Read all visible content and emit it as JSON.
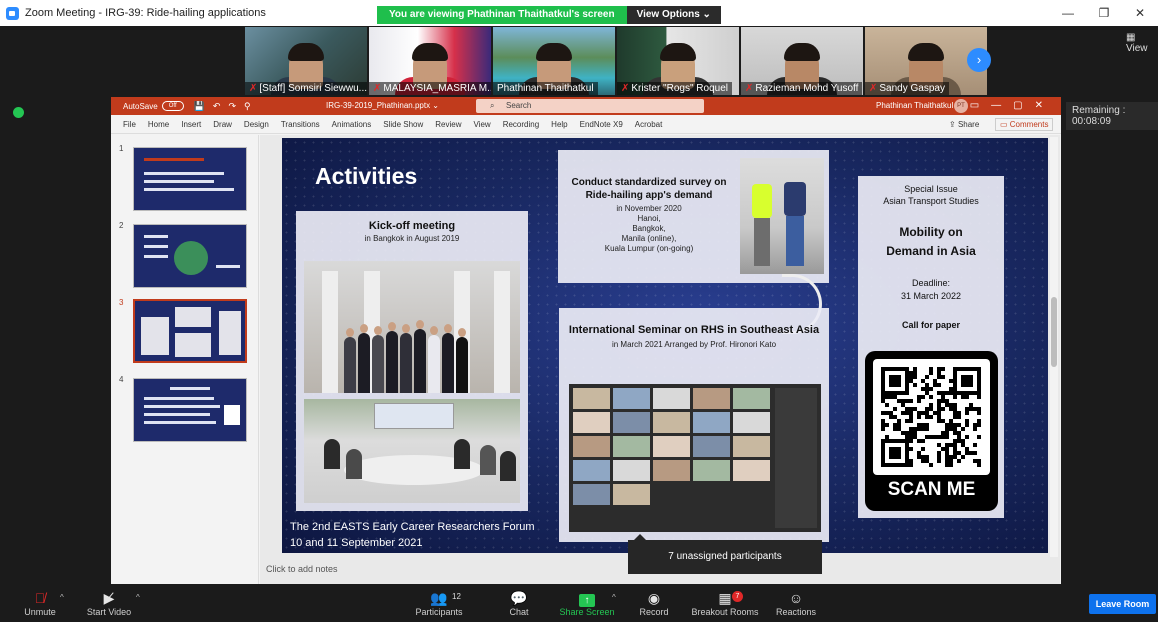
{
  "window": {
    "title": "Zoom Meeting - IRG-39: Ride-hailing applications",
    "controls": [
      "—",
      "❐",
      "✕"
    ]
  },
  "banner": {
    "viewing": "You are viewing Phathinan Thaithatkul's screen",
    "options": "View Options ⌄"
  },
  "participants_strip": [
    {
      "name": "[Staff] Somsiri Siewwu..."
    },
    {
      "name": "MALAYSIA_MASRIA M..."
    },
    {
      "name": "Phathinan Thaithatkul"
    },
    {
      "name": "Krister \"Rogs\" Roquel"
    },
    {
      "name": "Razieman Mohd Yusoff"
    },
    {
      "name": "Sandy Gaspay"
    }
  ],
  "view_label": "View",
  "remaining": "Remaining : 00:08:09",
  "ppt": {
    "autosave": "AutoSave",
    "autosave_state": "Off",
    "filename": "IRG-39-2019_Phathinan.pptx ⌄",
    "search_placeholder": "Search",
    "user": "Phathinan Thaithatkul",
    "avatar_initials": "PT",
    "tabs": [
      "File",
      "Home",
      "Insert",
      "Draw",
      "Design",
      "Transitions",
      "Animations",
      "Slide Show",
      "Review",
      "View",
      "Recording",
      "Help",
      "EndNote X9",
      "Acrobat"
    ],
    "share": "Share",
    "comments": "Comments",
    "slide_numbers": [
      "1",
      "2",
      "3",
      "4"
    ],
    "notes_placeholder": "Click to add notes"
  },
  "slide": {
    "title": "Activities",
    "kickoff": {
      "heading": "Kick-off meeting",
      "sub": "in Bangkok in August 2019"
    },
    "survey": {
      "heading": "Conduct standardized survey on Ride-hailing app's demand",
      "lines": [
        "in November 2020",
        "Hanoi,",
        "Bangkok,",
        "Manila (online),",
        "Kuala Lumpur (on-going)"
      ]
    },
    "seminar": {
      "heading": "International Seminar on RHS in Southeast Asia",
      "sub": "in March 2021 Arranged by Prof. Hironori Kato"
    },
    "special": {
      "line1": "Special Issue",
      "line2": "Asian Transport Studies",
      "title1": "Mobility on",
      "title2": "Demand in Asia",
      "deadline_label": "Deadline:",
      "deadline": "31 March 2022",
      "call": "Call for paper",
      "scan": "SCAN ME"
    },
    "footer1": "The 2nd EASTS Early Career Researchers Forum",
    "footer2": "10 and 11 September 2021"
  },
  "tooltip": "7 unassigned participants",
  "toolbar": {
    "unmute": "Unmute",
    "start_video": "Start Video",
    "participants": "Participants",
    "participants_count": "12",
    "chat": "Chat",
    "share_screen": "Share Screen",
    "record": "Record",
    "breakout_rooms": "Breakout Rooms",
    "breakout_badge": "7",
    "reactions": "Reactions",
    "leave": "Leave Room"
  },
  "colors": {
    "zoom_blue": "#2d8cff",
    "ppt_red": "#c13b1c",
    "share_green": "#24c653",
    "leave_blue": "#0e72ed",
    "mute_red": "#e02828"
  }
}
